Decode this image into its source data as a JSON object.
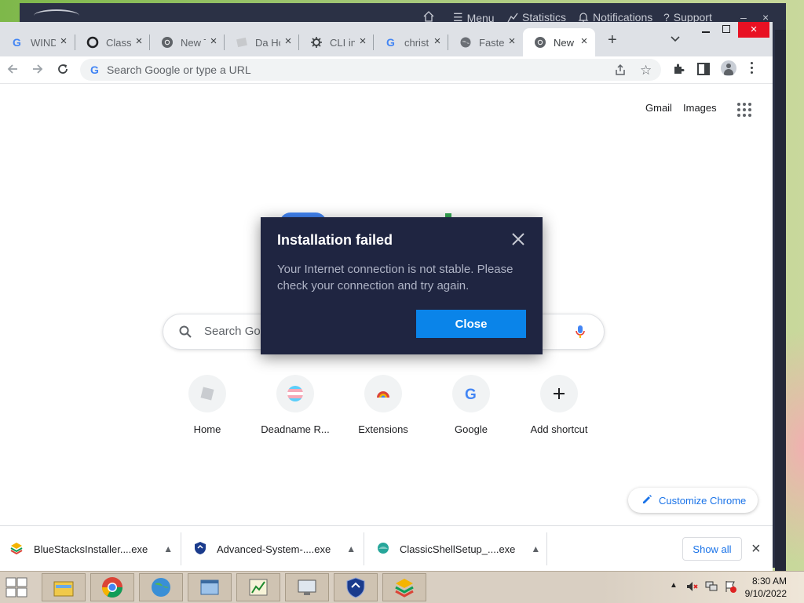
{
  "background_app": {
    "menu_label": "Menu",
    "statistics_label": "Statistics",
    "notifications_label": "Notifications",
    "support_label": "Support"
  },
  "chrome": {
    "tabs": [
      {
        "title": "WIND",
        "icon": "google-g-icon"
      },
      {
        "title": "Classi",
        "icon": "circle-o-icon"
      },
      {
        "title": "New T",
        "icon": "chrome-icon"
      },
      {
        "title": "Da Ho",
        "icon": "image-icon"
      },
      {
        "title": "CLI in",
        "icon": "gear-icon"
      },
      {
        "title": "christ",
        "icon": "google-g-icon"
      },
      {
        "title": "Faste",
        "icon": "globe-icon"
      },
      {
        "title": "New",
        "icon": "chrome-icon",
        "active": true
      }
    ],
    "omnibox_placeholder": "Search Google or type a URL"
  },
  "ntp": {
    "gmail_label": "Gmail",
    "images_label": "Images",
    "search_placeholder": "Search Go",
    "shortcuts": [
      {
        "label": "Home",
        "icon": "roblox-icon"
      },
      {
        "label": "Deadname R...",
        "icon": "trans-flag-icon"
      },
      {
        "label": "Extensions",
        "icon": "chrome-rainbow-icon"
      },
      {
        "label": "Google",
        "icon": "google-g-icon"
      },
      {
        "label": "Add shortcut",
        "icon": "plus-icon"
      }
    ],
    "customize_label": "Customize Chrome"
  },
  "downloads": {
    "items": [
      {
        "filename": "BlueStacksInstaller....exe",
        "icon": "bluestacks-icon"
      },
      {
        "filename": "Advanced-System-....exe",
        "icon": "shield-icon"
      },
      {
        "filename": "ClassicShellSetup_....exe",
        "icon": "shell-icon"
      }
    ],
    "show_all_label": "Show all"
  },
  "modal": {
    "title": "Installation failed",
    "message": "Your Internet connection is not stable. Please check your connection and try again.",
    "close_label": "Close"
  },
  "taskbar": {
    "time": "8:30 AM",
    "date": "9/10/2022",
    "apps": [
      "explorer-icon",
      "chrome-icon",
      "globe-icon",
      "window-icon",
      "chart-icon",
      "monitor-icon",
      "shield-icon",
      "bluestacks-icon"
    ]
  },
  "colors": {
    "modal_bg": "#1f2541",
    "modal_button": "#0a84e9",
    "chrome_blue": "#1a73e8",
    "tabstrip": "#dee1e6"
  }
}
